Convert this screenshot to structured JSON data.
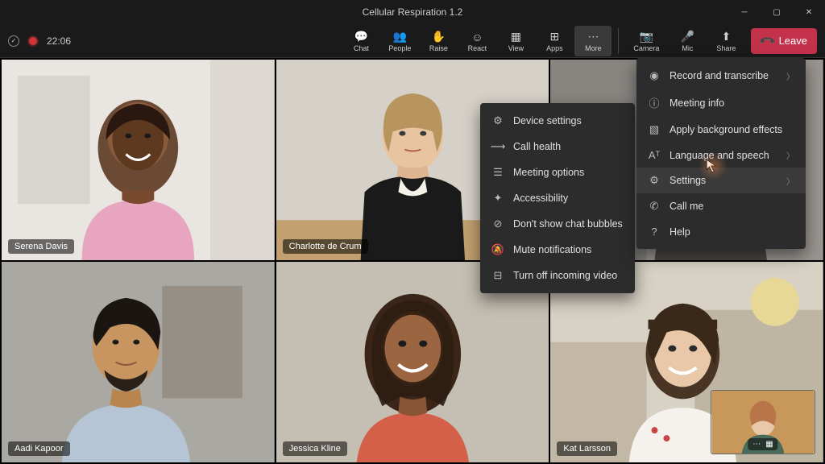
{
  "window": {
    "title": "Cellular Respiration 1.2"
  },
  "status": {
    "time": "22:06"
  },
  "toolbar": {
    "chat": "Chat",
    "people": "People",
    "raise": "Raise",
    "react": "React",
    "view": "View",
    "apps": "Apps",
    "more": "More",
    "camera": "Camera",
    "mic": "Mic",
    "share": "Share",
    "leave": "Leave"
  },
  "participants": [
    {
      "name": "Serena Davis"
    },
    {
      "name": "Charlotte de Crum"
    },
    {
      "name": ""
    },
    {
      "name": "Aadi Kapoor"
    },
    {
      "name": "Jessica Kline"
    },
    {
      "name": "Kat Larsson"
    }
  ],
  "submenu": [
    {
      "label": "Device settings",
      "icon": "gear"
    },
    {
      "label": "Call health",
      "icon": "pulse"
    },
    {
      "label": "Meeting options",
      "icon": "sliders"
    },
    {
      "label": "Accessibility",
      "icon": "accessibility"
    },
    {
      "label": "Don't show chat bubbles",
      "icon": "nobubble"
    },
    {
      "label": "Mute notifications",
      "icon": "bell-off"
    },
    {
      "label": "Turn off incoming video",
      "icon": "video-off"
    }
  ],
  "mainmenu": [
    {
      "label": "Record and transcribe",
      "icon": "record",
      "chevron": true,
      "dot": true
    },
    {
      "label": "Meeting info",
      "icon": "info"
    },
    {
      "label": "Apply background effects",
      "icon": "backdrop"
    },
    {
      "label": "Language and speech",
      "icon": "lang",
      "chevron": true
    },
    {
      "label": "Settings",
      "icon": "gear",
      "chevron": true
    },
    {
      "label": "Call me",
      "icon": "phone"
    },
    {
      "label": "Help",
      "icon": "help"
    }
  ]
}
